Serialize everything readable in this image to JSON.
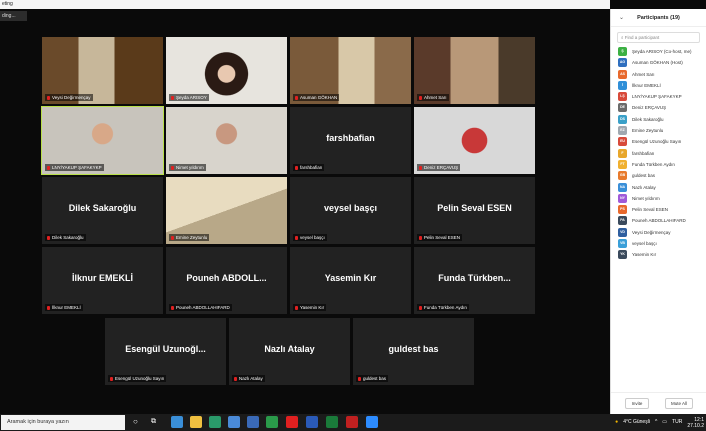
{
  "window": {
    "title": "eting",
    "rec_label": "ding..."
  },
  "tiles": [
    {
      "label": "Veysi Değirmençay",
      "name": "",
      "video": "bookshelf-man-glasses"
    },
    {
      "label": "Şeyda ARISOY",
      "name": "",
      "video": "woman-dark-hair"
    },
    {
      "label": "Asuman GÖKHAN",
      "name": "",
      "video": "woman-bookshelf"
    },
    {
      "label": "Ahmet Sarı",
      "name": "",
      "video": "man-glasses-bookshelf"
    },
    {
      "label": "LNY/YAKUP ŞAFAKYKP",
      "name": "",
      "video": "man-suit-office",
      "active": true
    },
    {
      "label": "Nimet yıldırım",
      "name": "",
      "video": "man-bald-office"
    },
    {
      "label": "farshbafian",
      "name": "farshbafian",
      "video": ""
    },
    {
      "label": "Deniz ERÇAVUŞ",
      "name": "",
      "video": "woman-red-top"
    },
    {
      "label": "Dilek Sakaroğlu",
      "name": "Dilek Sakaroğlu",
      "video": ""
    },
    {
      "label": "Emine Zeytunlu",
      "name": "",
      "video": "building-photo"
    },
    {
      "label": "veysel başçı",
      "name": "veysel başçı",
      "video": ""
    },
    {
      "label": "Pelin Seval ESEN",
      "name": "Pelin Seval ESEN",
      "video": ""
    },
    {
      "label": "İlknur EMEKLİ",
      "name": "İlknur EMEKLİ",
      "video": ""
    },
    {
      "label": "Pouneh ABDOLLAHIFARD",
      "name": "Pouneh ABDOLL...",
      "video": ""
    },
    {
      "label": "Yasemin Kır",
      "name": "Yasemin Kır",
      "video": ""
    },
    {
      "label": "Funda Türkben Aydın",
      "name": "Funda Türkben...",
      "video": ""
    },
    {
      "label": "Esengül Uzunoğlu Sayın",
      "name": "Esengül Uzunoğl...",
      "video": ""
    },
    {
      "label": "Nazlı Atalay",
      "name": "Nazlı Atalay",
      "video": ""
    },
    {
      "label": "guldest bas",
      "name": "guldest bas",
      "video": ""
    }
  ],
  "participants": {
    "title": "Participants (19)",
    "search_placeholder": "Find a participant",
    "invite_label": "Invite",
    "mute_all_label": "Mute All",
    "list": [
      {
        "initials": "Ş",
        "name": "Şeyda ARISOY (Co-host, me)",
        "color": "#3cb043"
      },
      {
        "initials": "AG",
        "name": "Asuman GÖKHAN (Host)",
        "color": "#2f6fbf"
      },
      {
        "initials": "AS",
        "name": "Ahmet Sarı",
        "color": "#e8692c"
      },
      {
        "initials": "İ",
        "name": "İlknur EMEKLİ",
        "color": "#2f8fd8"
      },
      {
        "initials": "LŞ",
        "name": "LNY/YAKUP ŞAFAKYKP",
        "color": "#d84a3a"
      },
      {
        "initials": "DE",
        "name": "Deniz ERÇAVUŞ",
        "color": "#6b6b6b"
      },
      {
        "initials": "DS",
        "name": "Dilek Sakaroğlu",
        "color": "#3aa0c8"
      },
      {
        "initials": "EZ",
        "name": "Emine Zeytunlu",
        "color": "#a0a8b0"
      },
      {
        "initials": "EU",
        "name": "Esengül Uzunoğlu Sayın",
        "color": "#d84a3a"
      },
      {
        "initials": "F",
        "name": "farshbafian",
        "color": "#e8a72c"
      },
      {
        "initials": "FT",
        "name": "Funda Türkben Aydın",
        "color": "#f0b030"
      },
      {
        "initials": "GB",
        "name": "guldest bas",
        "color": "#e87a2c"
      },
      {
        "initials": "NA",
        "name": "Nazlı Atalay",
        "color": "#3a8fd8"
      },
      {
        "initials": "NY",
        "name": "Nimet yıldırım",
        "color": "#a05ad8"
      },
      {
        "initials": "PS",
        "name": "Pelin Seval ESEN",
        "color": "#e8692c"
      },
      {
        "initials": "PA",
        "name": "Pouneh ABDOLLAHIFARD",
        "color": "#3a4a5c"
      },
      {
        "initials": "VD",
        "name": "Veysi Değirmençay",
        "color": "#2f5f9f"
      },
      {
        "initials": "VB",
        "name": "veysel başçı",
        "color": "#3a9fd8"
      },
      {
        "initials": "YK",
        "name": "Yasemin Kır",
        "color": "#3a4a5c"
      }
    ]
  },
  "taskbar": {
    "search_text": "Aramak için buraya yazın",
    "weather": "4°C Güneşli",
    "lang": "TUR",
    "time": "12:1",
    "date": "27.10.2"
  }
}
